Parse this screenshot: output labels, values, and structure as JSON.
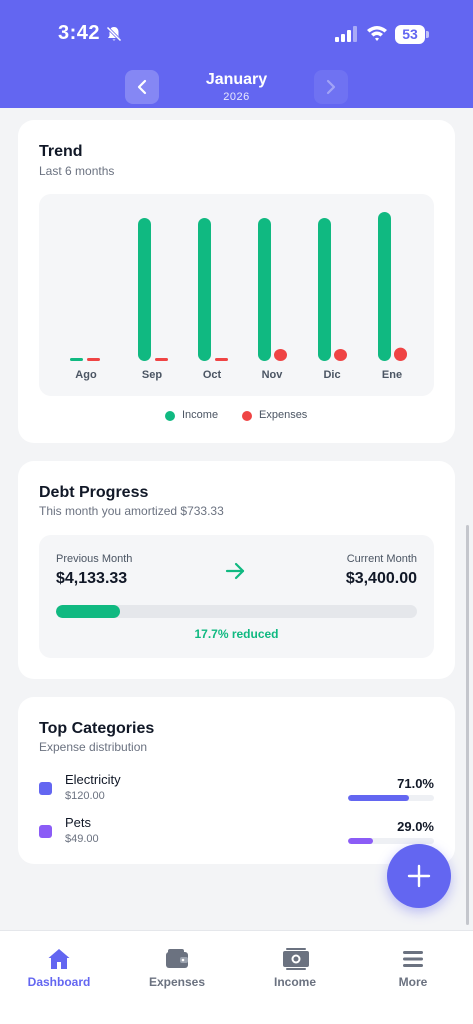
{
  "status_bar": {
    "time": "3:42",
    "battery": "53"
  },
  "header": {
    "month": "January",
    "year": "2026"
  },
  "trend": {
    "title": "Trend",
    "subtitle": "Last 6 months",
    "legend": {
      "income": "Income",
      "expenses": "Expenses"
    }
  },
  "chart_data": {
    "type": "bar",
    "categories": [
      "Ago",
      "Sep",
      "Oct",
      "Nov",
      "Dic",
      "Ene"
    ],
    "series": [
      {
        "name": "Income",
        "values": [
          0,
          96,
          96,
          96,
          96,
          100
        ],
        "color": "#10b981"
      },
      {
        "name": "Expenses",
        "values": [
          0,
          0,
          0,
          5,
          5,
          9
        ],
        "color": "#ef4444"
      }
    ],
    "ylim": [
      0,
      100
    ],
    "grid": false,
    "legend_position": "bottom"
  },
  "debt": {
    "title": "Debt Progress",
    "subtitle": "This month you amortized $733.33",
    "previous_label": "Previous Month",
    "previous_value": "$4,133.33",
    "current_label": "Current Month",
    "current_value": "$3,400.00",
    "progress": 0.177,
    "reduced_text": "17.7% reduced"
  },
  "categories": {
    "title": "Top Categories",
    "subtitle": "Expense distribution",
    "items": [
      {
        "name": "Electricity",
        "amount": "$120.00",
        "percent": "71.0%",
        "share": 0.71,
        "color": "#6366f1"
      },
      {
        "name": "Pets",
        "amount": "$49.00",
        "percent": "29.0%",
        "share": 0.29,
        "color": "#8b5cf6"
      }
    ]
  },
  "bottom_nav": {
    "items": [
      {
        "label": "Dashboard",
        "icon": "home-icon",
        "active": true
      },
      {
        "label": "Expenses",
        "icon": "wallet-icon",
        "active": false
      },
      {
        "label": "Income",
        "icon": "cash-icon",
        "active": false
      },
      {
        "label": "More",
        "icon": "menu-icon",
        "active": false
      }
    ]
  },
  "colors": {
    "primary": "#6366f1",
    "income": "#10b981",
    "expenses": "#ef4444"
  }
}
